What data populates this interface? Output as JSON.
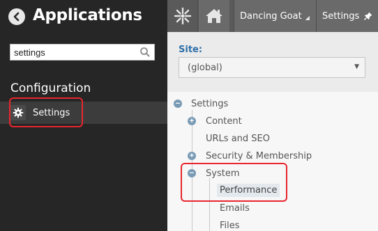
{
  "app": {
    "title": "Applications"
  },
  "search": {
    "value": "settings",
    "placeholder": ""
  },
  "section": {
    "title": "Configuration"
  },
  "nav_items": [
    {
      "label": "Settings",
      "icon": "gear-icon"
    }
  ],
  "topbar": {
    "site_label": "Dancing Goat",
    "settings_label": "Settings"
  },
  "site_selector": {
    "label": "Site:",
    "selected": "(global)"
  },
  "tree": {
    "root": "Settings",
    "content": "Content",
    "urls": "URLs and SEO",
    "security": "Security & Membership",
    "system": "System",
    "performance": "Performance",
    "emails": "Emails",
    "files": "Files"
  },
  "colors": {
    "highlight_border": "#e8262d",
    "site_label": "#2e6fa8",
    "toggle": "#7a9bb5"
  }
}
